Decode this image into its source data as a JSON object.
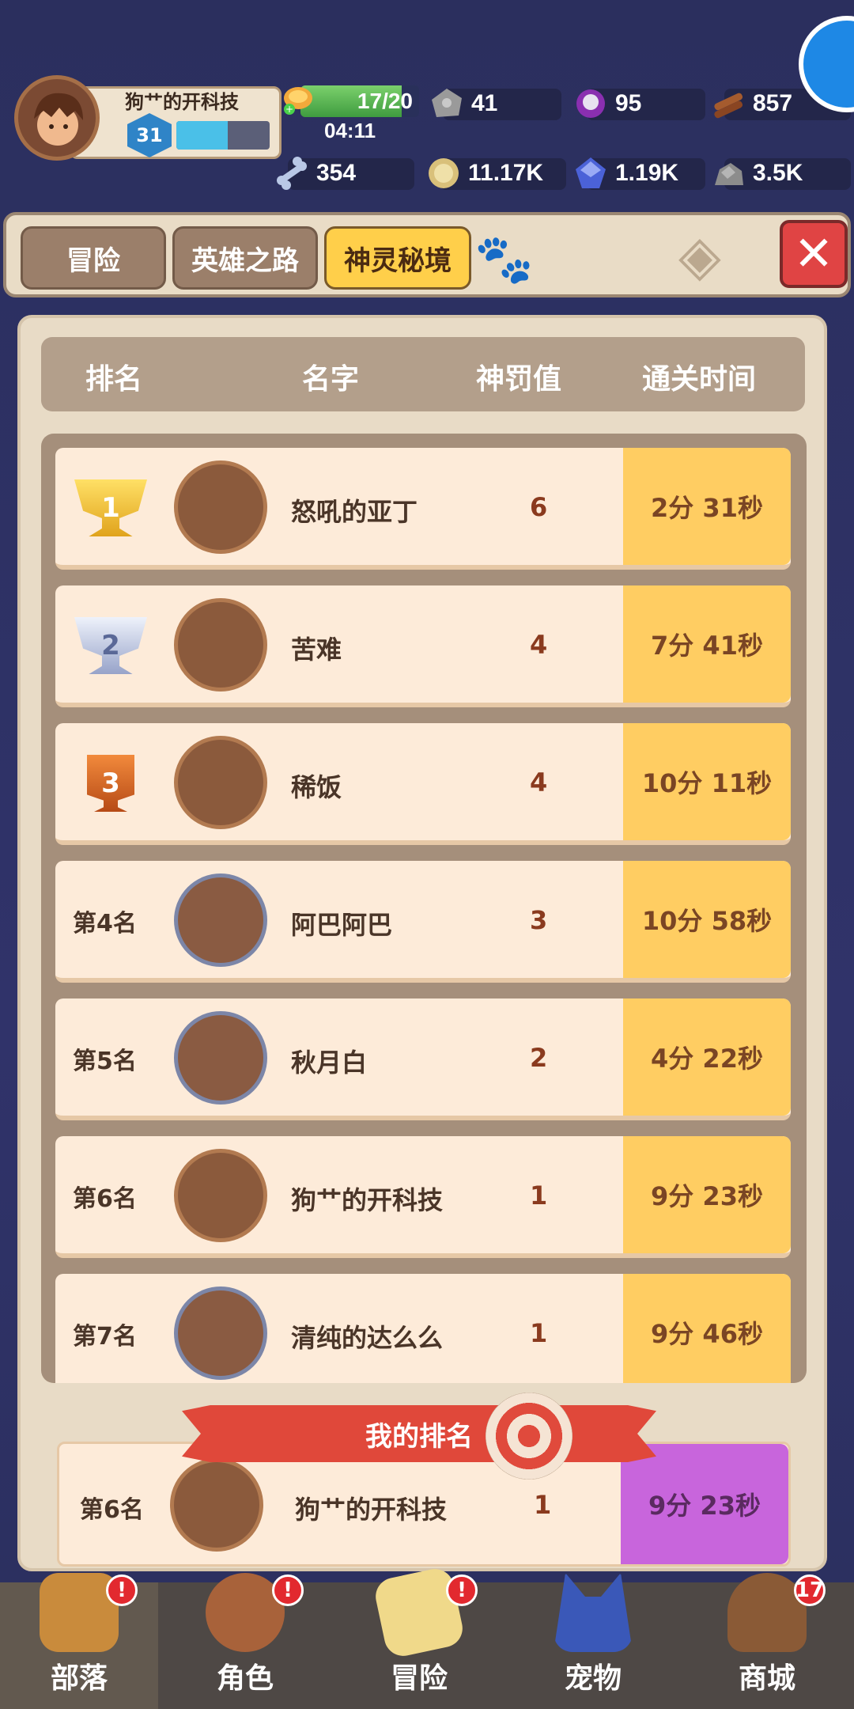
{
  "player": {
    "name": "狗艹的开科技",
    "level": "31",
    "xp_fraction": 0.55
  },
  "resources": {
    "stamina": "17/20",
    "stamina_fraction": 0.85,
    "timer": "04:11",
    "stone": "41",
    "orb": "95",
    "wood": "857",
    "bone": "354",
    "coin": "11.17K",
    "gem": "1.19K",
    "ore": "3.5K"
  },
  "tabs": [
    "冒险",
    "英雄之路",
    "神灵秘境"
  ],
  "active_tab": "神灵秘境",
  "table_headers": {
    "rank": "排名",
    "name": "名字",
    "penalty": "神罚值",
    "time": "通关时间"
  },
  "rows": [
    {
      "rank": "1",
      "name": "怒吼的亚丁",
      "penalty": "6",
      "time": "2分 31秒"
    },
    {
      "rank": "2",
      "name": "苦难",
      "penalty": "4",
      "time": "7分 41秒"
    },
    {
      "rank": "3",
      "name": "稀饭",
      "penalty": "4",
      "time": "10分 11秒"
    },
    {
      "rank": "第4名",
      "name": "阿巴阿巴",
      "penalty": "3",
      "time": "10分 58秒"
    },
    {
      "rank": "第5名",
      "name": "秋月白",
      "penalty": "2",
      "time": "4分 22秒"
    },
    {
      "rank": "第6名",
      "name": "狗艹的开科技",
      "penalty": "1",
      "time": "9分 23秒"
    },
    {
      "rank": "第7名",
      "name": "清纯的达么么",
      "penalty": "1",
      "time": "9分 46秒"
    }
  ],
  "my_rank": {
    "title": "我的排名",
    "rank": "第6名",
    "name": "狗艹的开科技",
    "penalty": "1",
    "time": "9分 23秒"
  },
  "nav": [
    {
      "label": "部落",
      "badge": "!"
    },
    {
      "label": "角色",
      "badge": "!"
    },
    {
      "label": "冒险",
      "badge": "!"
    },
    {
      "label": "宠物",
      "badge": ""
    },
    {
      "label": "商城",
      "badge": "17"
    }
  ],
  "colors": {
    "accent": "#ffcf4a",
    "time_cell": "#ffcd62",
    "my_time_cell": "#c865dc",
    "close": "#e04444"
  }
}
